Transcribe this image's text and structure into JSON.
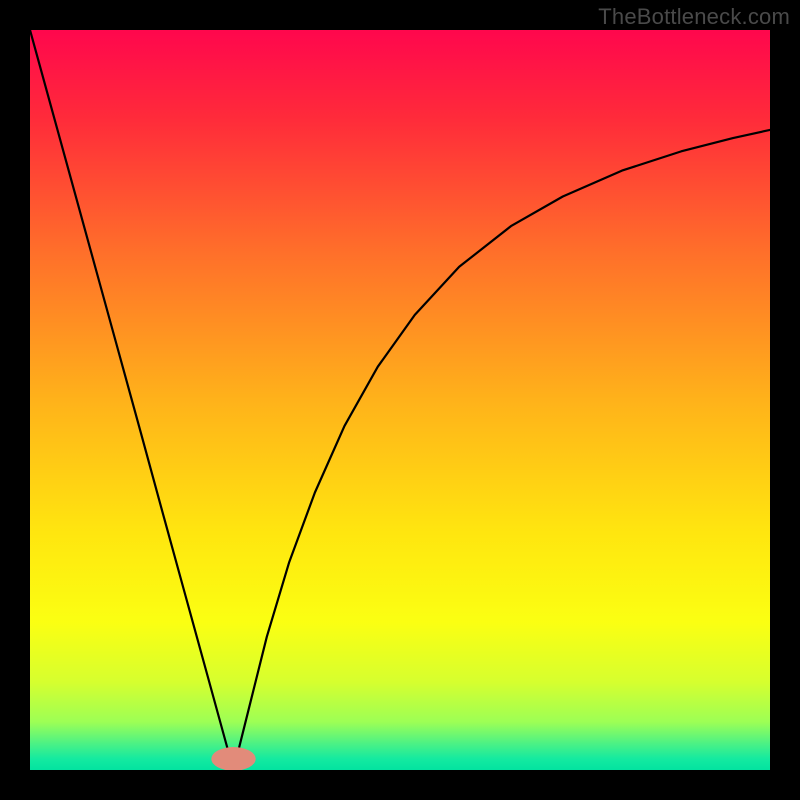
{
  "watermark": "TheBottleneck.com",
  "chart_data": {
    "type": "line",
    "title": "",
    "xlabel": "",
    "ylabel": "",
    "xlim": [
      0,
      100
    ],
    "ylim": [
      0,
      100
    ],
    "grid": false,
    "axes_visible": false,
    "background_gradient": {
      "stops": [
        {
          "offset": 0.0,
          "color": "#ff074d"
        },
        {
          "offset": 0.12,
          "color": "#ff2b3a"
        },
        {
          "offset": 0.3,
          "color": "#ff6f2a"
        },
        {
          "offset": 0.5,
          "color": "#ffb21a"
        },
        {
          "offset": 0.68,
          "color": "#ffe60f"
        },
        {
          "offset": 0.8,
          "color": "#fbff12"
        },
        {
          "offset": 0.88,
          "color": "#d7ff2e"
        },
        {
          "offset": 0.935,
          "color": "#9dff55"
        },
        {
          "offset": 0.965,
          "color": "#4af186"
        },
        {
          "offset": 0.985,
          "color": "#14eaa0"
        },
        {
          "offset": 1.0,
          "color": "#03e3a0"
        }
      ]
    },
    "marker": {
      "x": 27.5,
      "y": 1.5,
      "color": "#e28b7a",
      "rx": 3.0,
      "ry": 1.6
    },
    "series": [
      {
        "name": "left-branch",
        "x": [
          0.0,
          3.0,
          6.0,
          9.0,
          12.0,
          15.0,
          18.0,
          21.0,
          24.0,
          26.5,
          27.5
        ],
        "y": [
          100.0,
          89.1,
          78.2,
          67.3,
          56.4,
          45.5,
          34.5,
          23.6,
          12.7,
          3.6,
          0.0
        ]
      },
      {
        "name": "right-branch",
        "x": [
          27.5,
          29.5,
          32.0,
          35.0,
          38.5,
          42.5,
          47.0,
          52.0,
          58.0,
          65.0,
          72.0,
          80.0,
          88.0,
          95.0,
          100.0
        ],
        "y": [
          0.0,
          8.0,
          18.0,
          28.0,
          37.5,
          46.5,
          54.5,
          61.5,
          68.0,
          73.5,
          77.5,
          81.0,
          83.6,
          85.4,
          86.5
        ]
      }
    ]
  }
}
